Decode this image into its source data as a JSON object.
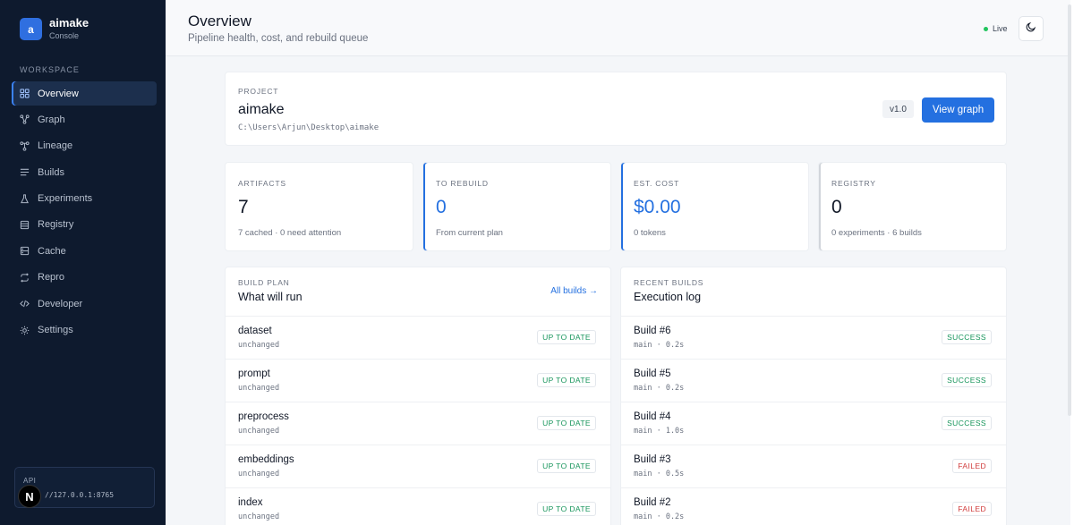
{
  "brand": {
    "logo_letter": "a",
    "name": "aimake",
    "subtitle": "Console"
  },
  "sidebar": {
    "section_label": "WORKSPACE",
    "items": [
      {
        "label": "Overview",
        "icon": "grid-icon"
      },
      {
        "label": "Graph",
        "icon": "graph-icon"
      },
      {
        "label": "Lineage",
        "icon": "lineage-icon"
      },
      {
        "label": "Builds",
        "icon": "list-icon"
      },
      {
        "label": "Experiments",
        "icon": "flask-icon"
      },
      {
        "label": "Registry",
        "icon": "database-icon"
      },
      {
        "label": "Cache",
        "icon": "cache-icon"
      },
      {
        "label": "Repro",
        "icon": "repeat-icon"
      },
      {
        "label": "Developer",
        "icon": "code-icon"
      },
      {
        "label": "Settings",
        "icon": "gear-icon"
      }
    ],
    "api": {
      "label": "API",
      "url": "//127.0.0.1:8765"
    },
    "badge_letter": "N"
  },
  "header": {
    "title": "Overview",
    "subtitle": "Pipeline health, cost, and rebuild queue",
    "live_label": "Live"
  },
  "project": {
    "eyebrow": "PROJECT",
    "name": "aimake",
    "path": "C:\\Users\\Arjun\\Desktop\\aimake",
    "version": "v1.0",
    "view_button": "View graph"
  },
  "stats": [
    {
      "label": "ARTIFACTS",
      "value": "7",
      "note": "7 cached · 0 need attention"
    },
    {
      "label": "TO REBUILD",
      "value": "0",
      "note": "From current plan"
    },
    {
      "label": "EST. COST",
      "value": "$0.00",
      "note": "0 tokens"
    },
    {
      "label": "REGISTRY",
      "value": "0",
      "note": "0 experiments · 6 builds"
    }
  ],
  "build_plan": {
    "eyebrow": "BUILD PLAN",
    "title": "What will run",
    "link": "All builds →",
    "rows": [
      {
        "name": "dataset",
        "meta": "unchanged",
        "status": "UP TO DATE"
      },
      {
        "name": "prompt",
        "meta": "unchanged",
        "status": "UP TO DATE"
      },
      {
        "name": "preprocess",
        "meta": "unchanged",
        "status": "UP TO DATE"
      },
      {
        "name": "embeddings",
        "meta": "unchanged",
        "status": "UP TO DATE"
      },
      {
        "name": "index",
        "meta": "unchanged",
        "status": "UP TO DATE"
      }
    ]
  },
  "recent_builds": {
    "eyebrow": "RECENT BUILDS",
    "title": "Execution log",
    "rows": [
      {
        "name": "Build #6",
        "meta": "main · 0.2s",
        "status": "SUCCESS"
      },
      {
        "name": "Build #5",
        "meta": "main · 0.2s",
        "status": "SUCCESS"
      },
      {
        "name": "Build #4",
        "meta": "main · 1.0s",
        "status": "SUCCESS"
      },
      {
        "name": "Build #3",
        "meta": "main · 0.5s",
        "status": "FAILED"
      },
      {
        "name": "Build #2",
        "meta": "main · 0.2s",
        "status": "FAILED"
      }
    ]
  },
  "colors": {
    "accent": "#2470e0",
    "success": "#15945a",
    "failed": "#d03b3b",
    "sidebar_bg": "#0e1a2e"
  }
}
